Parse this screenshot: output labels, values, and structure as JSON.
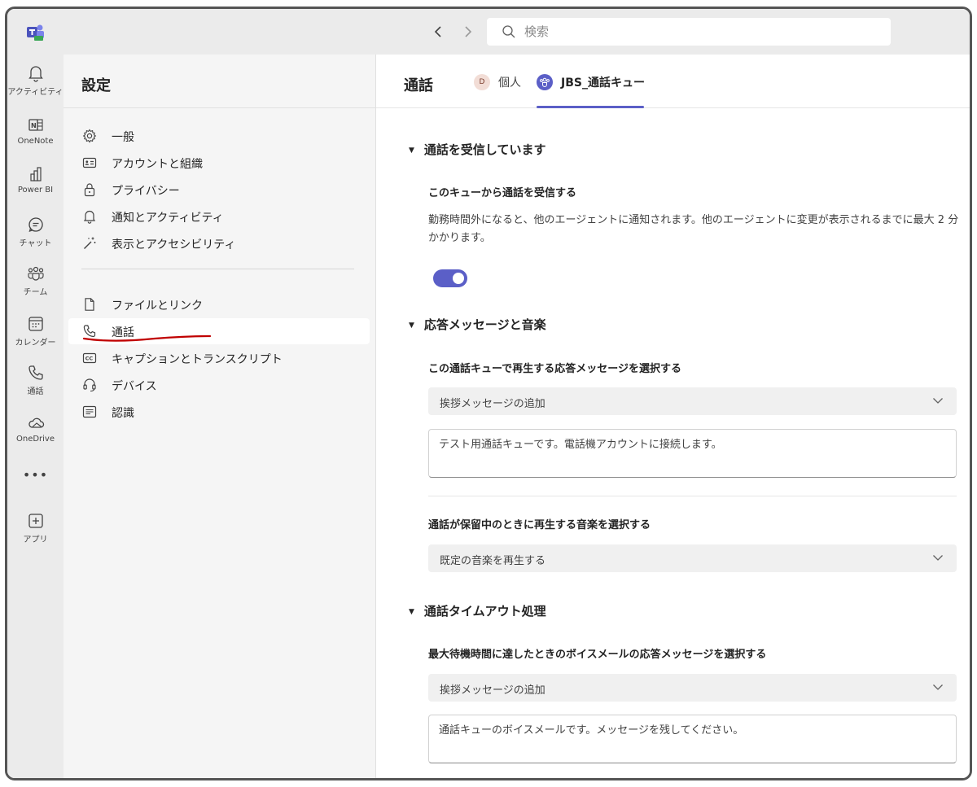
{
  "search": {
    "placeholder": "検索"
  },
  "rail": {
    "items": [
      {
        "label": "アクティビティ",
        "icon": "bell-icon"
      },
      {
        "label": "OneNote",
        "icon": "onenote-icon"
      },
      {
        "label": "Power BI",
        "icon": "powerbi-icon"
      },
      {
        "label": "チャット",
        "icon": "chat-icon"
      },
      {
        "label": "チーム",
        "icon": "teams-icon"
      },
      {
        "label": "カレンダー",
        "icon": "calendar-icon"
      },
      {
        "label": "通話",
        "icon": "phone-icon"
      },
      {
        "label": "OneDrive",
        "icon": "cloud-icon"
      },
      {
        "label": "•••",
        "icon": "more-icon"
      },
      {
        "label": "アプリ",
        "icon": "add-apps-icon"
      }
    ]
  },
  "settings": {
    "title": "設定",
    "menu": [
      {
        "label": "一般",
        "icon": "gear-icon"
      },
      {
        "label": "アカウントと組織",
        "icon": "id-card-icon"
      },
      {
        "label": "プライバシー",
        "icon": "lock-icon"
      },
      {
        "label": "通知とアクティビティ",
        "icon": "bell-icon"
      },
      {
        "label": "表示とアクセシビリティ",
        "icon": "magic-wand-icon"
      },
      {
        "label": "ファイルとリンク",
        "icon": "document-icon"
      },
      {
        "label": "通話",
        "icon": "phone-icon",
        "active": true
      },
      {
        "label": "キャプションとトランスクリプト",
        "icon": "closed-caption-icon"
      },
      {
        "label": "デバイス",
        "icon": "headset-icon"
      },
      {
        "label": "認識",
        "icon": "text-box-icon"
      }
    ]
  },
  "main": {
    "title": "通話",
    "tabs": [
      {
        "label": "個人",
        "avatar": "D"
      },
      {
        "label": "JBS_通話キュー",
        "avatar": "queue-people-icon",
        "active": true
      }
    ],
    "sections": {
      "receive": {
        "heading": "通話を受信しています",
        "sub_label": "このキューから通話を受信する",
        "description": "勤務時間外になると、他のエージェントに通知されます。他のエージェントに変更が表示されるまでに最大 2 分かかります。",
        "toggle_on": true
      },
      "greeting": {
        "heading": "応答メッセージと音楽",
        "greeting_label": "この通話キューで再生する応答メッセージを選択する",
        "greeting_dropdown": "挨拶メッセージの追加",
        "greeting_text": "テスト用通話キューです。電話機アカウントに接続します。",
        "hold_label": "通話が保留中のときに再生する音楽を選択する",
        "hold_dropdown": "既定の音楽を再生する"
      },
      "timeout": {
        "heading": "通話タイムアウト処理",
        "voicemail_label": "最大待機時間に達したときのボイスメールの応答メッセージを選択する",
        "voicemail_dropdown": "挨拶メッセージの追加",
        "voicemail_text": "通話キューのボイスメールです。メッセージを残してください。"
      }
    }
  },
  "colors": {
    "accent": "#5b5fc7",
    "annotation": "#c00000"
  }
}
